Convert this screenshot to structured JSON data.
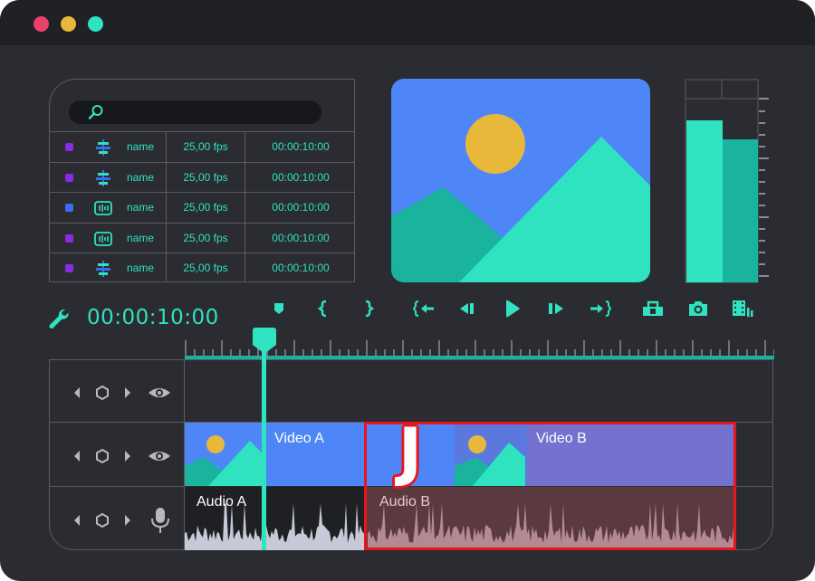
{
  "window": {
    "controls": [
      {
        "name": "close",
        "color": "#e8416e"
      },
      {
        "name": "minimize",
        "color": "#e8b83b"
      },
      {
        "name": "maximize",
        "color": "#2fe2c0"
      }
    ]
  },
  "media_browser": {
    "search": {
      "placeholder": ""
    },
    "rows": [
      {
        "swatch": "#8a2be2",
        "icon": "video-track-icon",
        "name": "name",
        "fps": "25,00 fps",
        "duration": "00:00:10:00"
      },
      {
        "swatch": "#8a2be2",
        "icon": "video-track-icon",
        "name": "name",
        "fps": "25,00 fps",
        "duration": "00:00:10:00"
      },
      {
        "swatch": "#3a6cf0",
        "icon": "audio-clip-icon",
        "name": "name",
        "fps": "25,00 fps",
        "duration": "00:00:10:00"
      },
      {
        "swatch": "#8a2be2",
        "icon": "audio-clip-icon",
        "name": "name",
        "fps": "25,00 fps",
        "duration": "00:00:10:00"
      },
      {
        "swatch": "#8a2be2",
        "icon": "video-track-icon",
        "name": "name",
        "fps": "25,00 fps",
        "duration": "00:00:10:00"
      }
    ]
  },
  "toolbar": {
    "timecode": "00:00:10:00",
    "buttons": [
      "wrench-icon",
      "marker-icon",
      "in-point-icon",
      "out-point-icon",
      "go-to-in-icon",
      "step-back-icon",
      "play-icon",
      "step-forward-icon",
      "go-to-out-icon",
      "insert-icon",
      "snapshot-icon",
      "film-export-icon"
    ]
  },
  "timeline": {
    "playhead_fraction": 0.133,
    "clips": {
      "video_a": "Video A",
      "video_b": "Video B",
      "audio_a": "Audio A",
      "audio_b": "Audio B"
    },
    "selection_hotkey": "J"
  },
  "colors": {
    "accent": "#2fe2c0",
    "video_a": "#4f86f7",
    "video_b": "#7472cf",
    "selection": "#e8141e"
  }
}
